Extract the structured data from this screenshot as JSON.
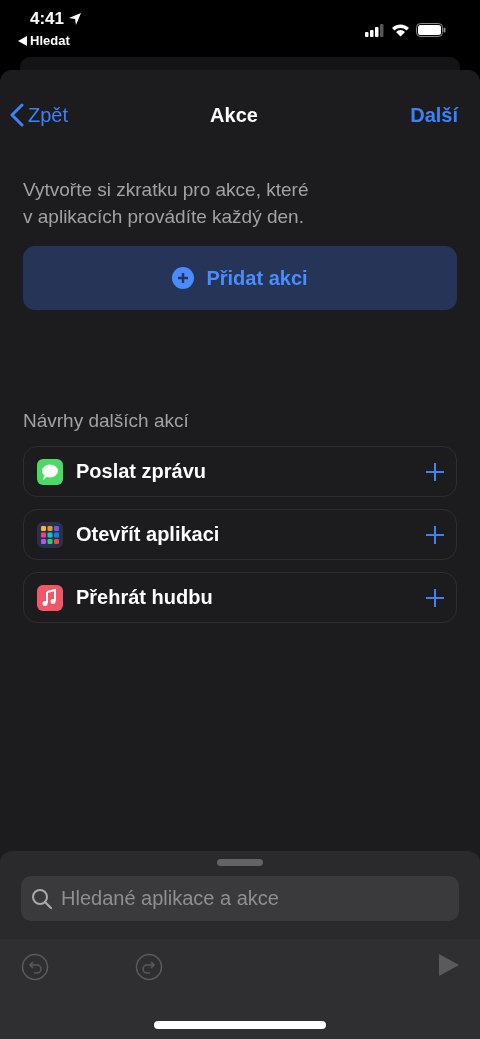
{
  "status_bar": {
    "time": "4:41",
    "back_link": "Hledat"
  },
  "nav": {
    "back": "Zpět",
    "title": "Akce",
    "next": "Další"
  },
  "description": "Vytvořte si zkratku pro akce, které\nv aplikacích provádíte každý den.",
  "add_button": "Přidat akci",
  "suggestions": {
    "heading": "Návrhy dalších akcí",
    "items": [
      {
        "kind": "messages",
        "label": "Poslat zprávu"
      },
      {
        "kind": "apps",
        "label": "Otevřít aplikaci"
      },
      {
        "kind": "music",
        "label": "Přehrát hudbu"
      }
    ]
  },
  "search": {
    "placeholder": "Hledané aplikace a akce"
  },
  "toolbar": [
    {
      "kind": "undo",
      "disabled": true
    },
    {
      "kind": "redo",
      "disabled": true
    },
    {
      "kind": "play",
      "disabled": true
    }
  ]
}
